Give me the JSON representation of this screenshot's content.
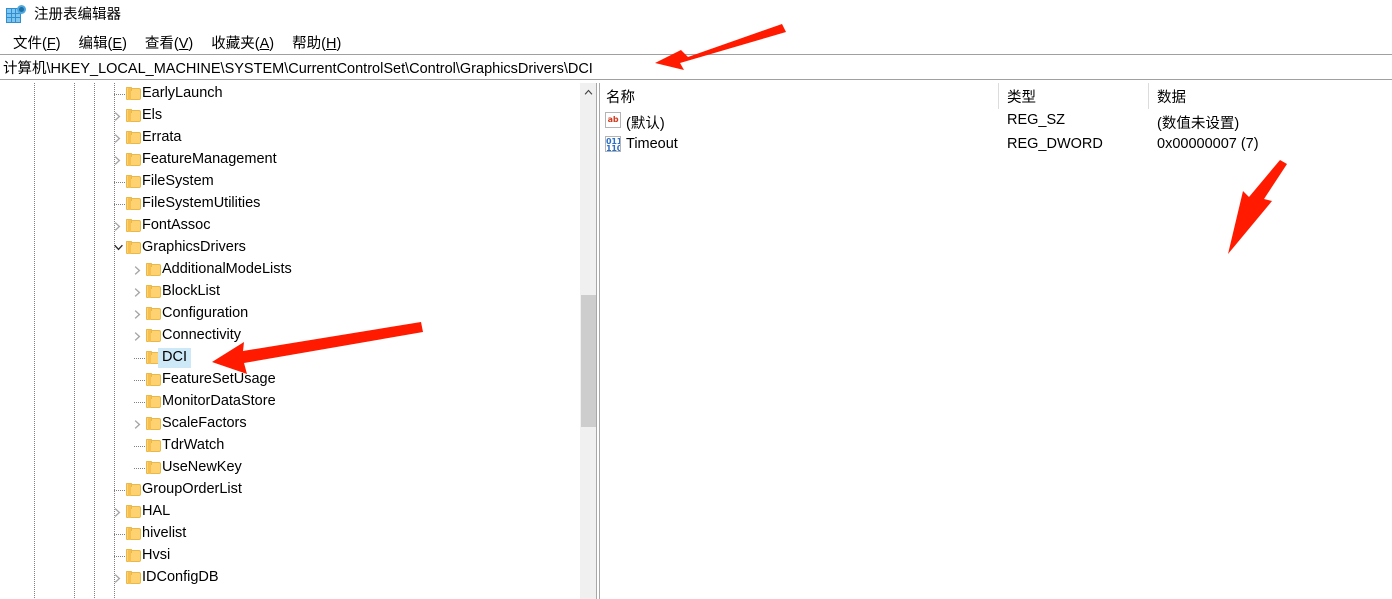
{
  "window": {
    "title": "注册表编辑器",
    "icon": "registry-editor-icon"
  },
  "menubar": {
    "items": [
      {
        "label": "文件(F)",
        "pre": "文件(",
        "key": "F",
        "post": ")"
      },
      {
        "label": "编辑(E)",
        "pre": "编辑(",
        "key": "E",
        "post": ")"
      },
      {
        "label": "查看(V)",
        "pre": "查看(",
        "key": "V",
        "post": ")"
      },
      {
        "label": "收藏夹(A)",
        "pre": "收藏夹(",
        "key": "A",
        "post": ")"
      },
      {
        "label": "帮助(H)",
        "pre": "帮助(",
        "key": "H",
        "post": ")"
      }
    ]
  },
  "address": {
    "path": "计算机\\HKEY_LOCAL_MACHINE\\SYSTEM\\CurrentControlSet\\Control\\GraphicsDrivers\\DCI"
  },
  "tree": {
    "nodes": [
      {
        "label": "EarlyLaunch",
        "depth": 1,
        "expander": "none",
        "selected": false
      },
      {
        "label": "Els",
        "depth": 1,
        "expander": "collapsed",
        "selected": false
      },
      {
        "label": "Errata",
        "depth": 1,
        "expander": "collapsed",
        "selected": false
      },
      {
        "label": "FeatureManagement",
        "depth": 1,
        "expander": "collapsed",
        "selected": false
      },
      {
        "label": "FileSystem",
        "depth": 1,
        "expander": "none",
        "selected": false
      },
      {
        "label": "FileSystemUtilities",
        "depth": 1,
        "expander": "none",
        "selected": false
      },
      {
        "label": "FontAssoc",
        "depth": 1,
        "expander": "collapsed",
        "selected": false
      },
      {
        "label": "GraphicsDrivers",
        "depth": 1,
        "expander": "expanded",
        "selected": false
      },
      {
        "label": "AdditionalModeLists",
        "depth": 2,
        "expander": "collapsed",
        "selected": false
      },
      {
        "label": "BlockList",
        "depth": 2,
        "expander": "collapsed",
        "selected": false
      },
      {
        "label": "Configuration",
        "depth": 2,
        "expander": "collapsed",
        "selected": false
      },
      {
        "label": "Connectivity",
        "depth": 2,
        "expander": "collapsed",
        "selected": false
      },
      {
        "label": "DCI",
        "depth": 2,
        "expander": "none",
        "selected": true
      },
      {
        "label": "FeatureSetUsage",
        "depth": 2,
        "expander": "none",
        "selected": false
      },
      {
        "label": "MonitorDataStore",
        "depth": 2,
        "expander": "none",
        "selected": false
      },
      {
        "label": "ScaleFactors",
        "depth": 2,
        "expander": "collapsed",
        "selected": false
      },
      {
        "label": "TdrWatch",
        "depth": 2,
        "expander": "none",
        "selected": false
      },
      {
        "label": "UseNewKey",
        "depth": 2,
        "expander": "none",
        "selected": false
      },
      {
        "label": "GroupOrderList",
        "depth": 1,
        "expander": "none",
        "selected": false
      },
      {
        "label": "HAL",
        "depth": 1,
        "expander": "collapsed",
        "selected": false
      },
      {
        "label": "hivelist",
        "depth": 1,
        "expander": "none",
        "selected": false
      },
      {
        "label": "Hvsi",
        "depth": 1,
        "expander": "none",
        "selected": false
      },
      {
        "label": "IDConfigDB",
        "depth": 1,
        "expander": "collapsed",
        "selected": false
      }
    ],
    "scrollbar": {
      "up_arrow": "▲"
    }
  },
  "list": {
    "columns": [
      {
        "label": "名称"
      },
      {
        "label": "类型"
      },
      {
        "label": "数据"
      }
    ],
    "rows": [
      {
        "name": "(默认)",
        "type": "REG_SZ",
        "data": "(数值未设置)",
        "icon": "string-value-icon"
      },
      {
        "name": "Timeout",
        "type": "REG_DWORD",
        "data": "0x00000007 (7)",
        "icon": "dword-value-icon"
      }
    ]
  },
  "annotations": {
    "color": "#ff1a00",
    "arrows": [
      {
        "name": "arrow-to-address-bar",
        "target": "address-bar"
      },
      {
        "name": "arrow-to-dci-node",
        "target": "tree-node-dci"
      },
      {
        "name": "arrow-to-timeout-data",
        "target": "timeout-data-cell"
      }
    ]
  }
}
